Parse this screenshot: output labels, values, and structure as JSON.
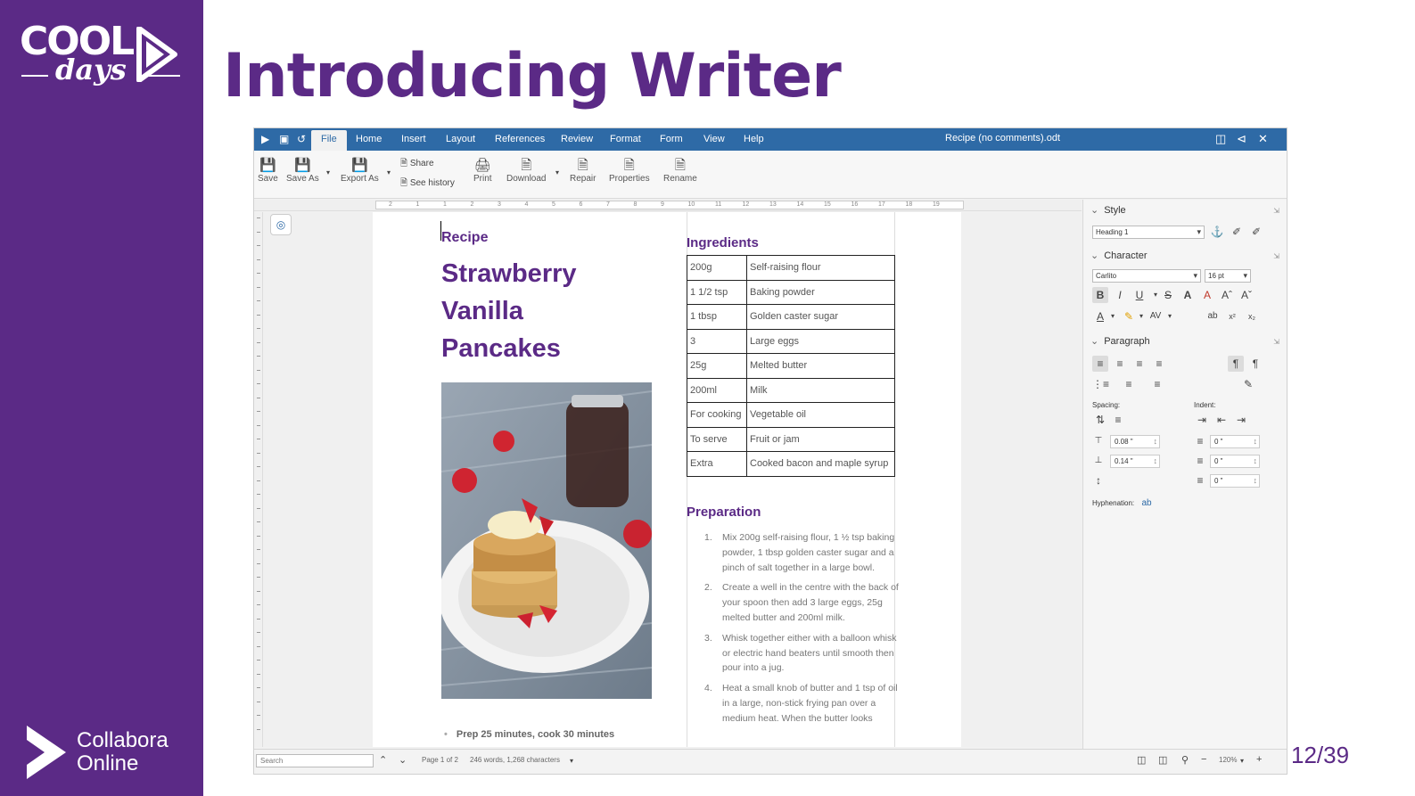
{
  "slide": {
    "title": "Introducing Writer",
    "page_number": "12/39",
    "colors": {
      "brand_purple": "#5b2a86",
      "app_blue": "#2e6aa6"
    },
    "logo_top": {
      "line1": "COOL",
      "line2": "days"
    },
    "logo_bottom": {
      "line1": "Collabora",
      "line2": "Online"
    }
  },
  "app": {
    "menubar": {
      "tabs": [
        "File",
        "Home",
        "Insert",
        "Layout",
        "References",
        "Review",
        "Format",
        "Form",
        "View",
        "Help"
      ],
      "active_tab": "File",
      "document_title": "Recipe (no comments).odt"
    },
    "toolbar": {
      "save": "Save",
      "save_as": "Save As",
      "export_as": "Export As",
      "share": "Share",
      "see_history": "See history",
      "print": "Print",
      "download": "Download",
      "repair": "Repair",
      "properties": "Properties",
      "rename": "Rename"
    },
    "ruler_numbers": [
      "2",
      "1",
      "1",
      "2",
      "3",
      "4",
      "5",
      "6",
      "7",
      "8",
      "9",
      "10",
      "11",
      "12",
      "13",
      "14",
      "15",
      "16",
      "17",
      "18",
      "19"
    ],
    "document": {
      "recipe_label": "Recipe",
      "title": "Strawberry Vanilla Pancakes",
      "ingredients_heading": "Ingredients",
      "ingredients": [
        {
          "qty": "200g",
          "item": "Self-raising flour"
        },
        {
          "qty": "1 1/2 tsp",
          "item": "Baking powder"
        },
        {
          "qty": "1 tbsp",
          "item": "Golden caster sugar"
        },
        {
          "qty": "3",
          "item": "Large eggs"
        },
        {
          "qty": "25g",
          "item": "Melted butter"
        },
        {
          "qty": "200ml",
          "item": "Milk"
        },
        {
          "qty": "For cooking",
          "item": "Vegetable oil"
        },
        {
          "qty": "To serve",
          "item": "Fruit or jam"
        },
        {
          "qty": "Extra",
          "item": "Cooked bacon and maple syrup"
        }
      ],
      "preparation_heading": "Preparation",
      "steps": [
        {
          "num": "1.",
          "text": "Mix 200g self-raising flour, 1 ½ tsp baking powder, 1 tbsp golden caster sugar and a pinch of salt together in a large bowl."
        },
        {
          "num": "2.",
          "text": "Create a well in the centre with the back of your spoon then add 3 large eggs, 25g melted butter and 200ml milk."
        },
        {
          "num": "3.",
          "text": "Whisk together either with a balloon whisk or electric hand beaters until smooth then pour into a jug."
        },
        {
          "num": "4.",
          "text": "Heat a small knob of butter and 1 tsp of oil in a large, non-stick frying pan over a medium heat. When the butter looks"
        }
      ],
      "prep_time": "Prep 25 minutes, cook 30 minutes"
    },
    "sidebar": {
      "style_heading": "Style",
      "paragraph_style": "Heading 1",
      "character_heading": "Character",
      "font_name": "Carlito",
      "font_size": "16 pt",
      "paragraph_heading": "Paragraph",
      "spacing_label": "Spacing:",
      "indent_label": "Indent:",
      "spacing_above": "0.08 \"",
      "spacing_below": "0.14 \"",
      "indent_before": "0 \"",
      "indent_after": "0 \"",
      "indent_first": "0 \"",
      "hyphenation_label": "Hyphenation:"
    },
    "statusbar": {
      "search_placeholder": "Search",
      "page_info": "Page 1 of 2",
      "word_count": "246 words, 1,268 characters",
      "zoom": "120%"
    }
  }
}
